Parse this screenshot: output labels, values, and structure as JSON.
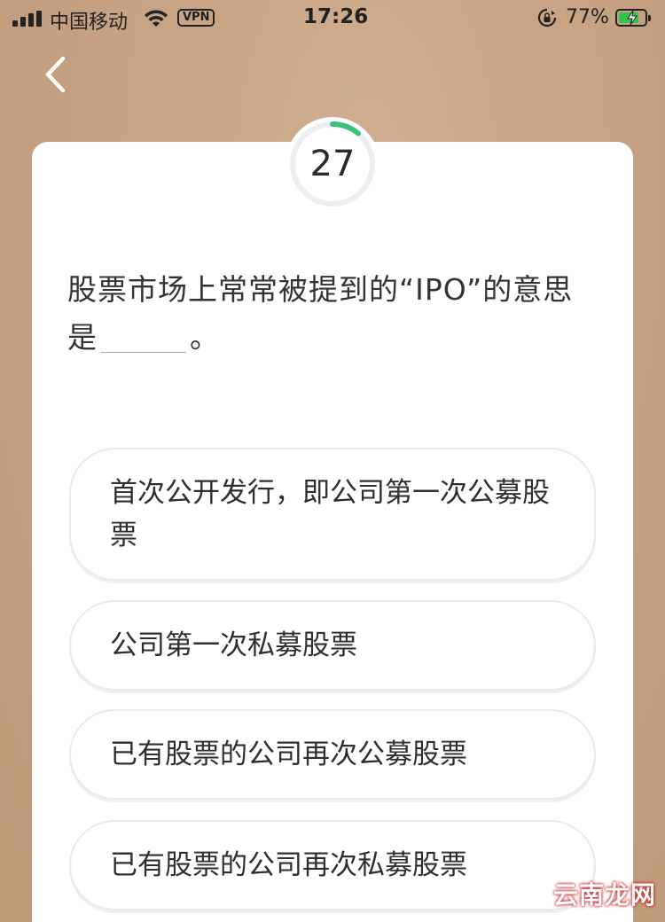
{
  "status_bar": {
    "carrier": "中国移动",
    "vpn": "VPN",
    "time": "17:26",
    "battery_percent": "77%",
    "battery_level": 0.77
  },
  "quiz": {
    "question_number": "27",
    "progress_color": "#3bc27a",
    "question_before_blank": "股票市场上常常被提到的“IPO”的意思是",
    "question_after_blank": "。",
    "options": [
      "首次公开发行，即公司第一次公募股票",
      "公司第一次私募股票",
      "已有股票的公司再次公募股票",
      "已有股票的公司再次私募股票"
    ]
  },
  "watermark": "云南龙网"
}
